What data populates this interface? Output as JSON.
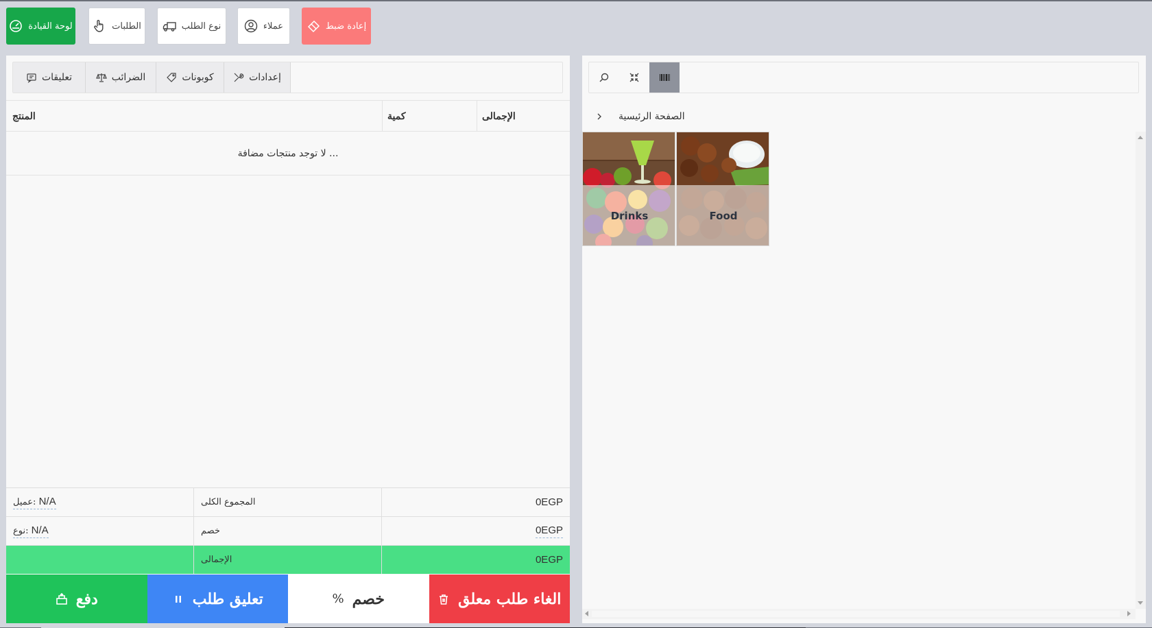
{
  "toolbar": {
    "dashboard_label": "لوحة القيادة",
    "orders_label": "الطلبات",
    "order_type_label": "نوع الطلب",
    "customers_label": "عملاء",
    "reset_label": "إعادة ضبط"
  },
  "cart": {
    "tabs": {
      "comments": "تعليقات",
      "taxes": "الضرائب",
      "coupons": "كوبونات",
      "settings": "إعدادات"
    },
    "columns": {
      "product": "المنتج",
      "quantity": "كمية",
      "total": "الإجمالى"
    },
    "empty_message": "... لا توجد منتجات مضافة",
    "summary": {
      "customer_label": "عميل:",
      "customer_value": "N/A",
      "type_label": "نوع:",
      "type_value": "N/A",
      "subtotal_label": "المجموع الكلى",
      "subtotal_value": "0EGP",
      "discount_label": "خصم",
      "discount_value": "0EGP",
      "grand_total_label": "الإجمالى",
      "grand_total_value": "0EGP"
    },
    "actions": {
      "pay": "دفع",
      "hold": "تعليق طلب",
      "discount": "خصم",
      "discount_symbol": "%",
      "cancel": "الغاء طلب معلق"
    }
  },
  "catalog": {
    "breadcrumb_home": "الصفحة الرئيسية",
    "categories": [
      {
        "name": "Drinks"
      },
      {
        "name": "Food"
      }
    ]
  },
  "colors": {
    "dashboard": "#17a74a",
    "reset": "#fb7a7a",
    "pay": "#1fc35a",
    "hold": "#3e86f5",
    "cancel": "#ef3e46",
    "grand_total_row": "#49df85"
  }
}
